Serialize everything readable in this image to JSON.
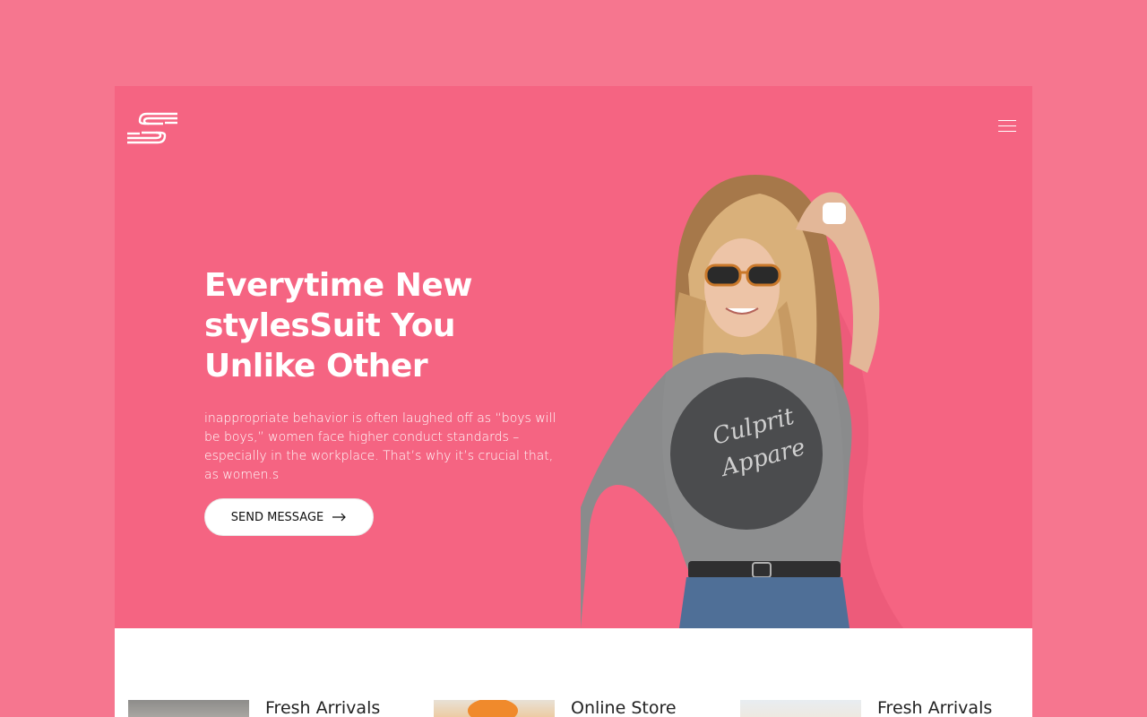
{
  "brand": {
    "logo_icon": "s-stripes-logo-icon"
  },
  "header": {
    "menu_icon": "hamburger-menu-icon"
  },
  "hero": {
    "title": "Everytime New stylesSuit You Unlike Other",
    "description": "inappropriate behavior is often laughed off as “boys will be boys,” women face higher conduct standards – especially in the workplace. That’s why it’s crucial that, as women.s",
    "cta_label": "SEND MESSAGE",
    "cta_icon": "arrow-right-icon",
    "shirt_text_line1": "Culprit",
    "shirt_text_line2": "Appare"
  },
  "cards": [
    {
      "title": "Fresh Arrivals",
      "thumb_color": "#7d7c7a"
    },
    {
      "title": "Online Store",
      "thumb_color": "#f08a2c"
    },
    {
      "title": "Fresh Arrivals",
      "thumb_color": "#dde3e8"
    }
  ],
  "colors": {
    "page_bg": "#f6768f",
    "hero_bg": "#f56482",
    "white": "#ffffff"
  }
}
